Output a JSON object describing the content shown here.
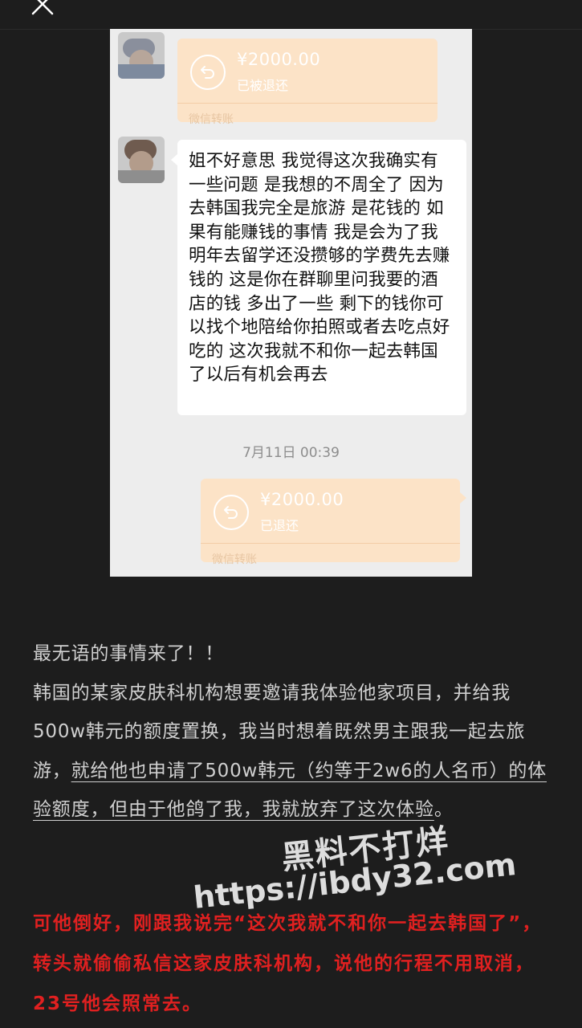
{
  "chat": {
    "transfer_top": {
      "amount": "¥2000.00",
      "status": "已被退还",
      "label": "微信转账"
    },
    "message": "姐不好意思 我觉得这次我确实有一些问题  是我想的不周全了 因为去韩国我完全是旅游 是花钱的 如果有能赚钱的事情 我是会为了我明年去留学还没攒够的学费先去赚钱的 这是你在群聊里问我要的酒店的钱 多出了一些 剩下的钱你可以找个地陪给你拍照或者去吃点好吃的 这次我就不和你一起去韩国了以后有机会再去",
    "timestamp": "7月11日 00:39",
    "transfer_bottom": {
      "amount": "¥2000.00",
      "status": "已退还",
      "label": "微信转账"
    }
  },
  "article": {
    "line1": "最无语的事情来了！！",
    "p2_plain": "韩国的某家皮肤科机构想要邀请我体验他家项目，并给我500w韩元的额度置换，我当时想着既然男主跟我一起去旅游，",
    "p2_underlined": "就给他也申请了500w韩元（约等于2w6的人名币）的体验额度，但由于他鸽了我，我就放弃了这次体验",
    "p2_end": "。",
    "red_text": "可他倒好，刚跟我说完“这次我就不和你一起去韩国了”，转头就偷偷私信这家皮肤科机构，说他的行程不用取消，23号他会照常去。"
  },
  "watermark": {
    "line1": "黑料不打烊",
    "line2": "https://ibdy32.com"
  }
}
